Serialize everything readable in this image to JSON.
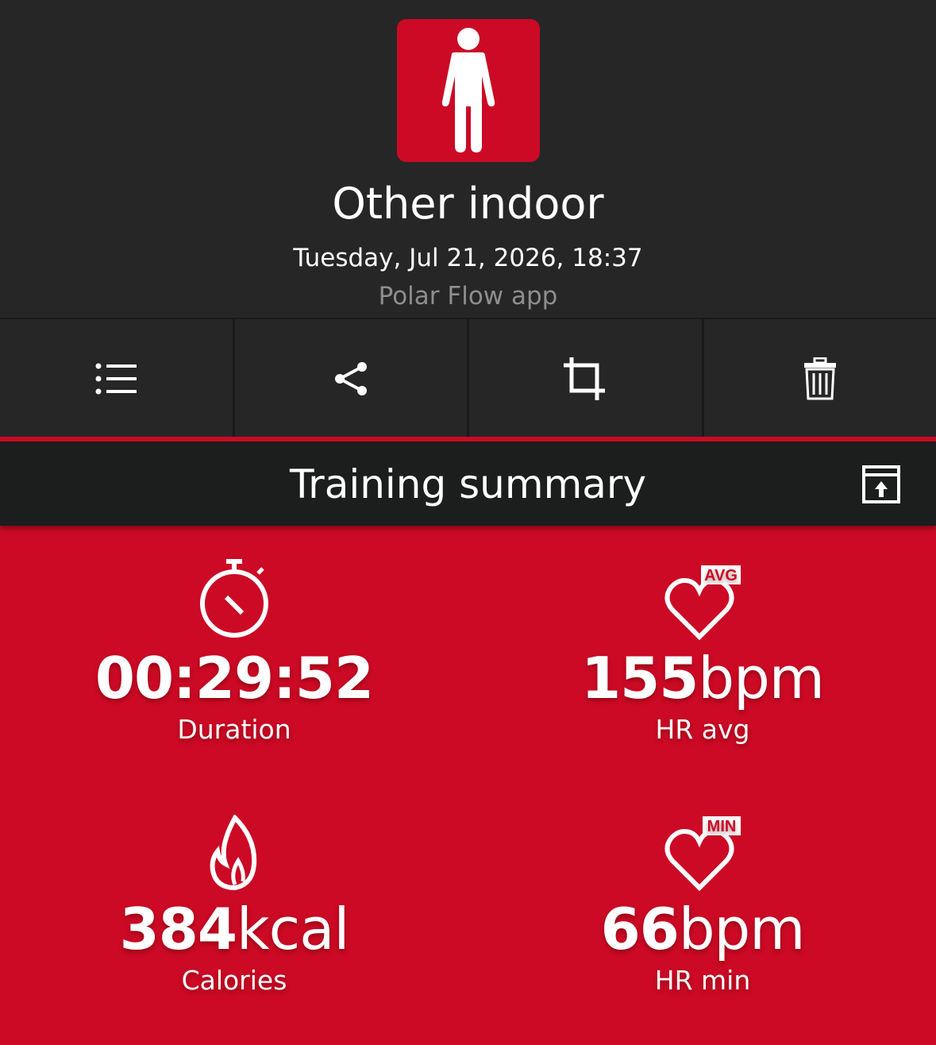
{
  "header": {
    "sport_icon": "person-standing-icon",
    "title": "Other indoor",
    "datetime": "Tuesday, Jul 21, 2026, 18:37",
    "source": "Polar Flow app"
  },
  "toolbar": [
    {
      "name": "list-icon"
    },
    {
      "name": "share-icon"
    },
    {
      "name": "crop-icon"
    },
    {
      "name": "trash-icon"
    }
  ],
  "section": {
    "title": "Training summary",
    "action_icon": "export-icon"
  },
  "stats": {
    "duration": {
      "value": "00:29:52",
      "unit": "",
      "label": "Duration",
      "icon": "stopwatch-icon"
    },
    "hr_avg": {
      "value": "155",
      "unit": "bpm",
      "label": "HR avg",
      "icon": "heart-avg-icon",
      "badge": "AVG"
    },
    "calories": {
      "value": "384",
      "unit": "kcal",
      "label": "Calories",
      "icon": "flame-icon"
    },
    "hr_min": {
      "value": "66",
      "unit": "bpm",
      "label": "HR min",
      "icon": "heart-min-icon",
      "badge": "MIN"
    }
  },
  "colors": {
    "accent": "#cc0a25",
    "background": "#262627",
    "section_bar": "#1c1d1d",
    "muted_text": "#8e8e8e"
  }
}
